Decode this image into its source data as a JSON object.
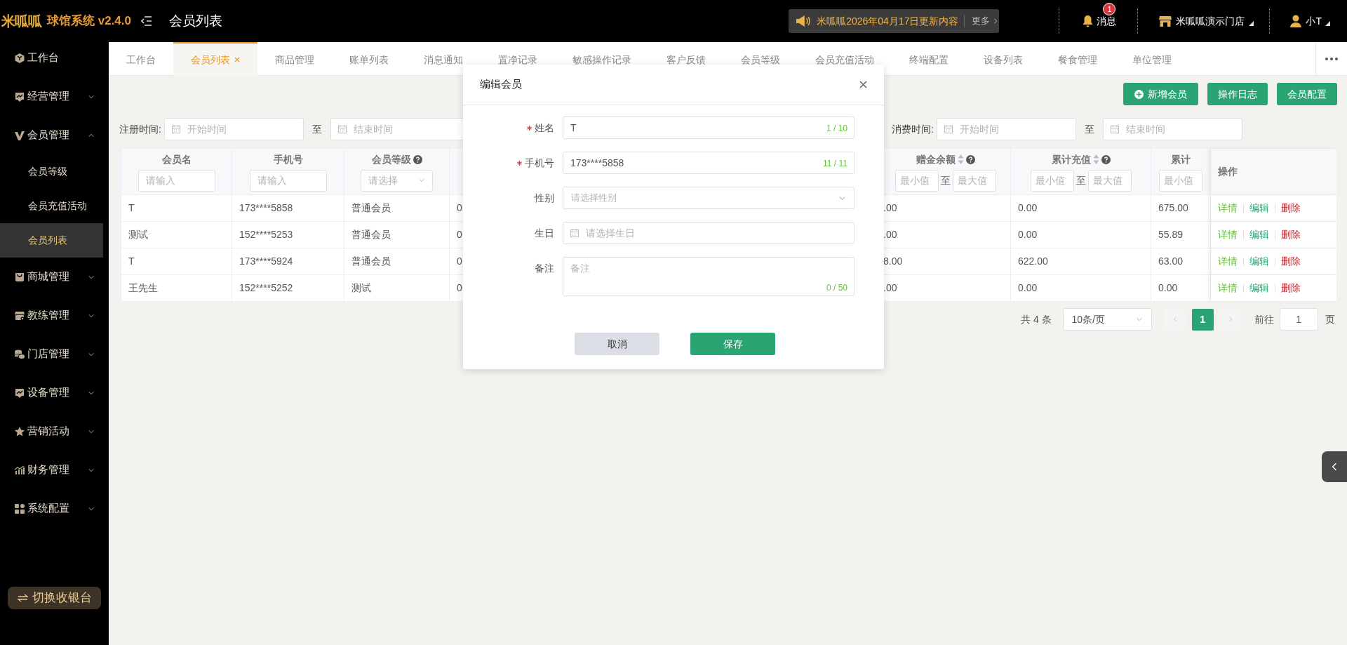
{
  "header": {
    "logo": "米呱呱",
    "app_name": "球馆系统 v2.4.0",
    "page_title": "会员列表",
    "notice": {
      "text": "米呱呱2026年04月17日更新内容",
      "more": "更多"
    },
    "messages": {
      "label": "消息",
      "badge": "1"
    },
    "store": "米呱呱演示门店",
    "user": "小T"
  },
  "sidebar": {
    "items": [
      {
        "label": "工作台",
        "kind": "link",
        "selected": false
      },
      {
        "label": "经营管理",
        "kind": "group",
        "selected": false,
        "expanded": false
      },
      {
        "label": "会员管理",
        "kind": "group",
        "selected": false,
        "expanded": true,
        "children": [
          {
            "label": "会员等级",
            "selected": false
          },
          {
            "label": "会员充值活动",
            "selected": false
          },
          {
            "label": "会员列表",
            "selected": true
          }
        ]
      },
      {
        "label": "商城管理",
        "kind": "group",
        "selected": false,
        "expanded": false
      },
      {
        "label": "教练管理",
        "kind": "group",
        "selected": false,
        "expanded": false
      },
      {
        "label": "门店管理",
        "kind": "group",
        "selected": false,
        "expanded": false
      },
      {
        "label": "设备管理",
        "kind": "group",
        "selected": false,
        "expanded": false
      },
      {
        "label": "营销活动",
        "kind": "group",
        "selected": false,
        "expanded": false
      },
      {
        "label": "财务管理",
        "kind": "group",
        "selected": false,
        "expanded": false
      },
      {
        "label": "系统配置",
        "kind": "group",
        "selected": false,
        "expanded": false
      }
    ],
    "switch_button": "切换收银台"
  },
  "tabs": [
    {
      "label": "工作台",
      "selected": false,
      "closable": false
    },
    {
      "label": "会员列表",
      "selected": true,
      "closable": true
    },
    {
      "label": "商品管理",
      "selected": false,
      "closable": false
    },
    {
      "label": "账单列表",
      "selected": false,
      "closable": false
    },
    {
      "label": "消息通知",
      "selected": false,
      "closable": false
    },
    {
      "label": "置净记录",
      "selected": false,
      "closable": false
    },
    {
      "label": "敏感操作记录",
      "selected": false,
      "closable": false
    },
    {
      "label": "客户反馈",
      "selected": false,
      "closable": false
    },
    {
      "label": "会员等级",
      "selected": false,
      "closable": false
    },
    {
      "label": "会员充值活动",
      "selected": false,
      "closable": false
    },
    {
      "label": "终端配置",
      "selected": false,
      "closable": false
    },
    {
      "label": "设备列表",
      "selected": false,
      "closable": false
    },
    {
      "label": "餐食管理",
      "selected": false,
      "closable": false
    },
    {
      "label": "单位管理",
      "selected": false,
      "closable": false
    }
  ],
  "toolbar_buttons": [
    {
      "label": "新增会员",
      "kind": "add"
    },
    {
      "label": "操作日志",
      "kind": "plain"
    },
    {
      "label": "会员配置",
      "kind": "plain"
    }
  ],
  "filters": [
    {
      "label": "注册时间:",
      "start_placeholder": "开始时间",
      "separator": "至",
      "end_placeholder": "结束时间"
    },
    {
      "label": "消费时间:",
      "start_placeholder": "开始时间",
      "separator": "至",
      "end_placeholder": "结束时间"
    }
  ],
  "table": {
    "columns": [
      {
        "title": "会员名",
        "filter": {
          "kind": "text",
          "placeholder": "请输入"
        }
      },
      {
        "title": "手机号",
        "filter": {
          "kind": "text",
          "placeholder": "请输入"
        }
      },
      {
        "title": "会员等级",
        "help": true,
        "filter": {
          "kind": "select",
          "placeholder": "请选择"
        }
      },
      {},
      {
        "title": "赠金余额",
        "sortable": true,
        "help": true,
        "filter": {
          "kind": "range",
          "min_placeholder": "最小值",
          "separator": "至",
          "max_placeholder": "最大值"
        }
      },
      {
        "title": "累计充值",
        "sortable": true,
        "help": true,
        "filter": {
          "kind": "range",
          "min_placeholder": "最小值",
          "separator": "至",
          "max_placeholder": "最大值"
        }
      },
      {
        "title": "累计",
        "filter": {
          "kind": "range",
          "min_placeholder": "最小值"
        }
      }
    ],
    "actions_title": "操作",
    "rows": [
      {
        "cells": [
          "T",
          "173****5858",
          "普通会员",
          "0",
          ".00",
          "0.00",
          "675.00"
        ],
        "actions": [
          {
            "label": "详情",
            "kind": "detail"
          },
          {
            "label": "编辑",
            "kind": "edit"
          },
          {
            "label": "删除",
            "kind": "delete"
          }
        ]
      },
      {
        "cells": [
          "测试",
          "152****5253",
          "普通会员",
          "0",
          ".00",
          "0.00",
          "55.89"
        ],
        "actions": [
          {
            "label": "详情",
            "kind": "detail"
          },
          {
            "label": "编辑",
            "kind": "edit"
          },
          {
            "label": "删除",
            "kind": "delete"
          }
        ]
      },
      {
        "cells": [
          "T",
          "173****5924",
          "普通会员",
          "0",
          "8.00",
          "622.00",
          "63.00"
        ],
        "actions": [
          {
            "label": "详情",
            "kind": "detail"
          },
          {
            "label": "编辑",
            "kind": "edit"
          },
          {
            "label": "删除",
            "kind": "delete"
          }
        ]
      },
      {
        "cells": [
          "王先生",
          "152****5252",
          "测试",
          "0",
          ".00",
          "0.00",
          "0.00"
        ],
        "actions": [
          {
            "label": "详情",
            "kind": "detail"
          },
          {
            "label": "编辑",
            "kind": "edit"
          },
          {
            "label": "删除",
            "kind": "delete"
          }
        ]
      }
    ]
  },
  "pagination": {
    "total": "共 4 条",
    "page_size": "10条/页",
    "pages": [
      {
        "label": "1",
        "selected": true
      }
    ],
    "goto_label": "前往",
    "goto_value": "1",
    "page_unit": "页"
  },
  "modal": {
    "title": "编辑会员",
    "fields": [
      {
        "label": "姓名",
        "required": true,
        "kind": "text",
        "value": "T",
        "counter": "1 / 10"
      },
      {
        "label": "手机号",
        "required": true,
        "kind": "text",
        "value": "173****5858",
        "counter": "11 / 11"
      },
      {
        "label": "性别",
        "kind": "select",
        "placeholder": "请选择性别"
      },
      {
        "label": "生日",
        "kind": "date",
        "placeholder": "请选择生日"
      },
      {
        "label": "备注",
        "kind": "textarea",
        "placeholder": "备注",
        "counter": "0 / 50"
      }
    ],
    "buttons": [
      {
        "label": "取消",
        "kind": "secondary"
      },
      {
        "label": "保存",
        "kind": "primary"
      }
    ]
  }
}
